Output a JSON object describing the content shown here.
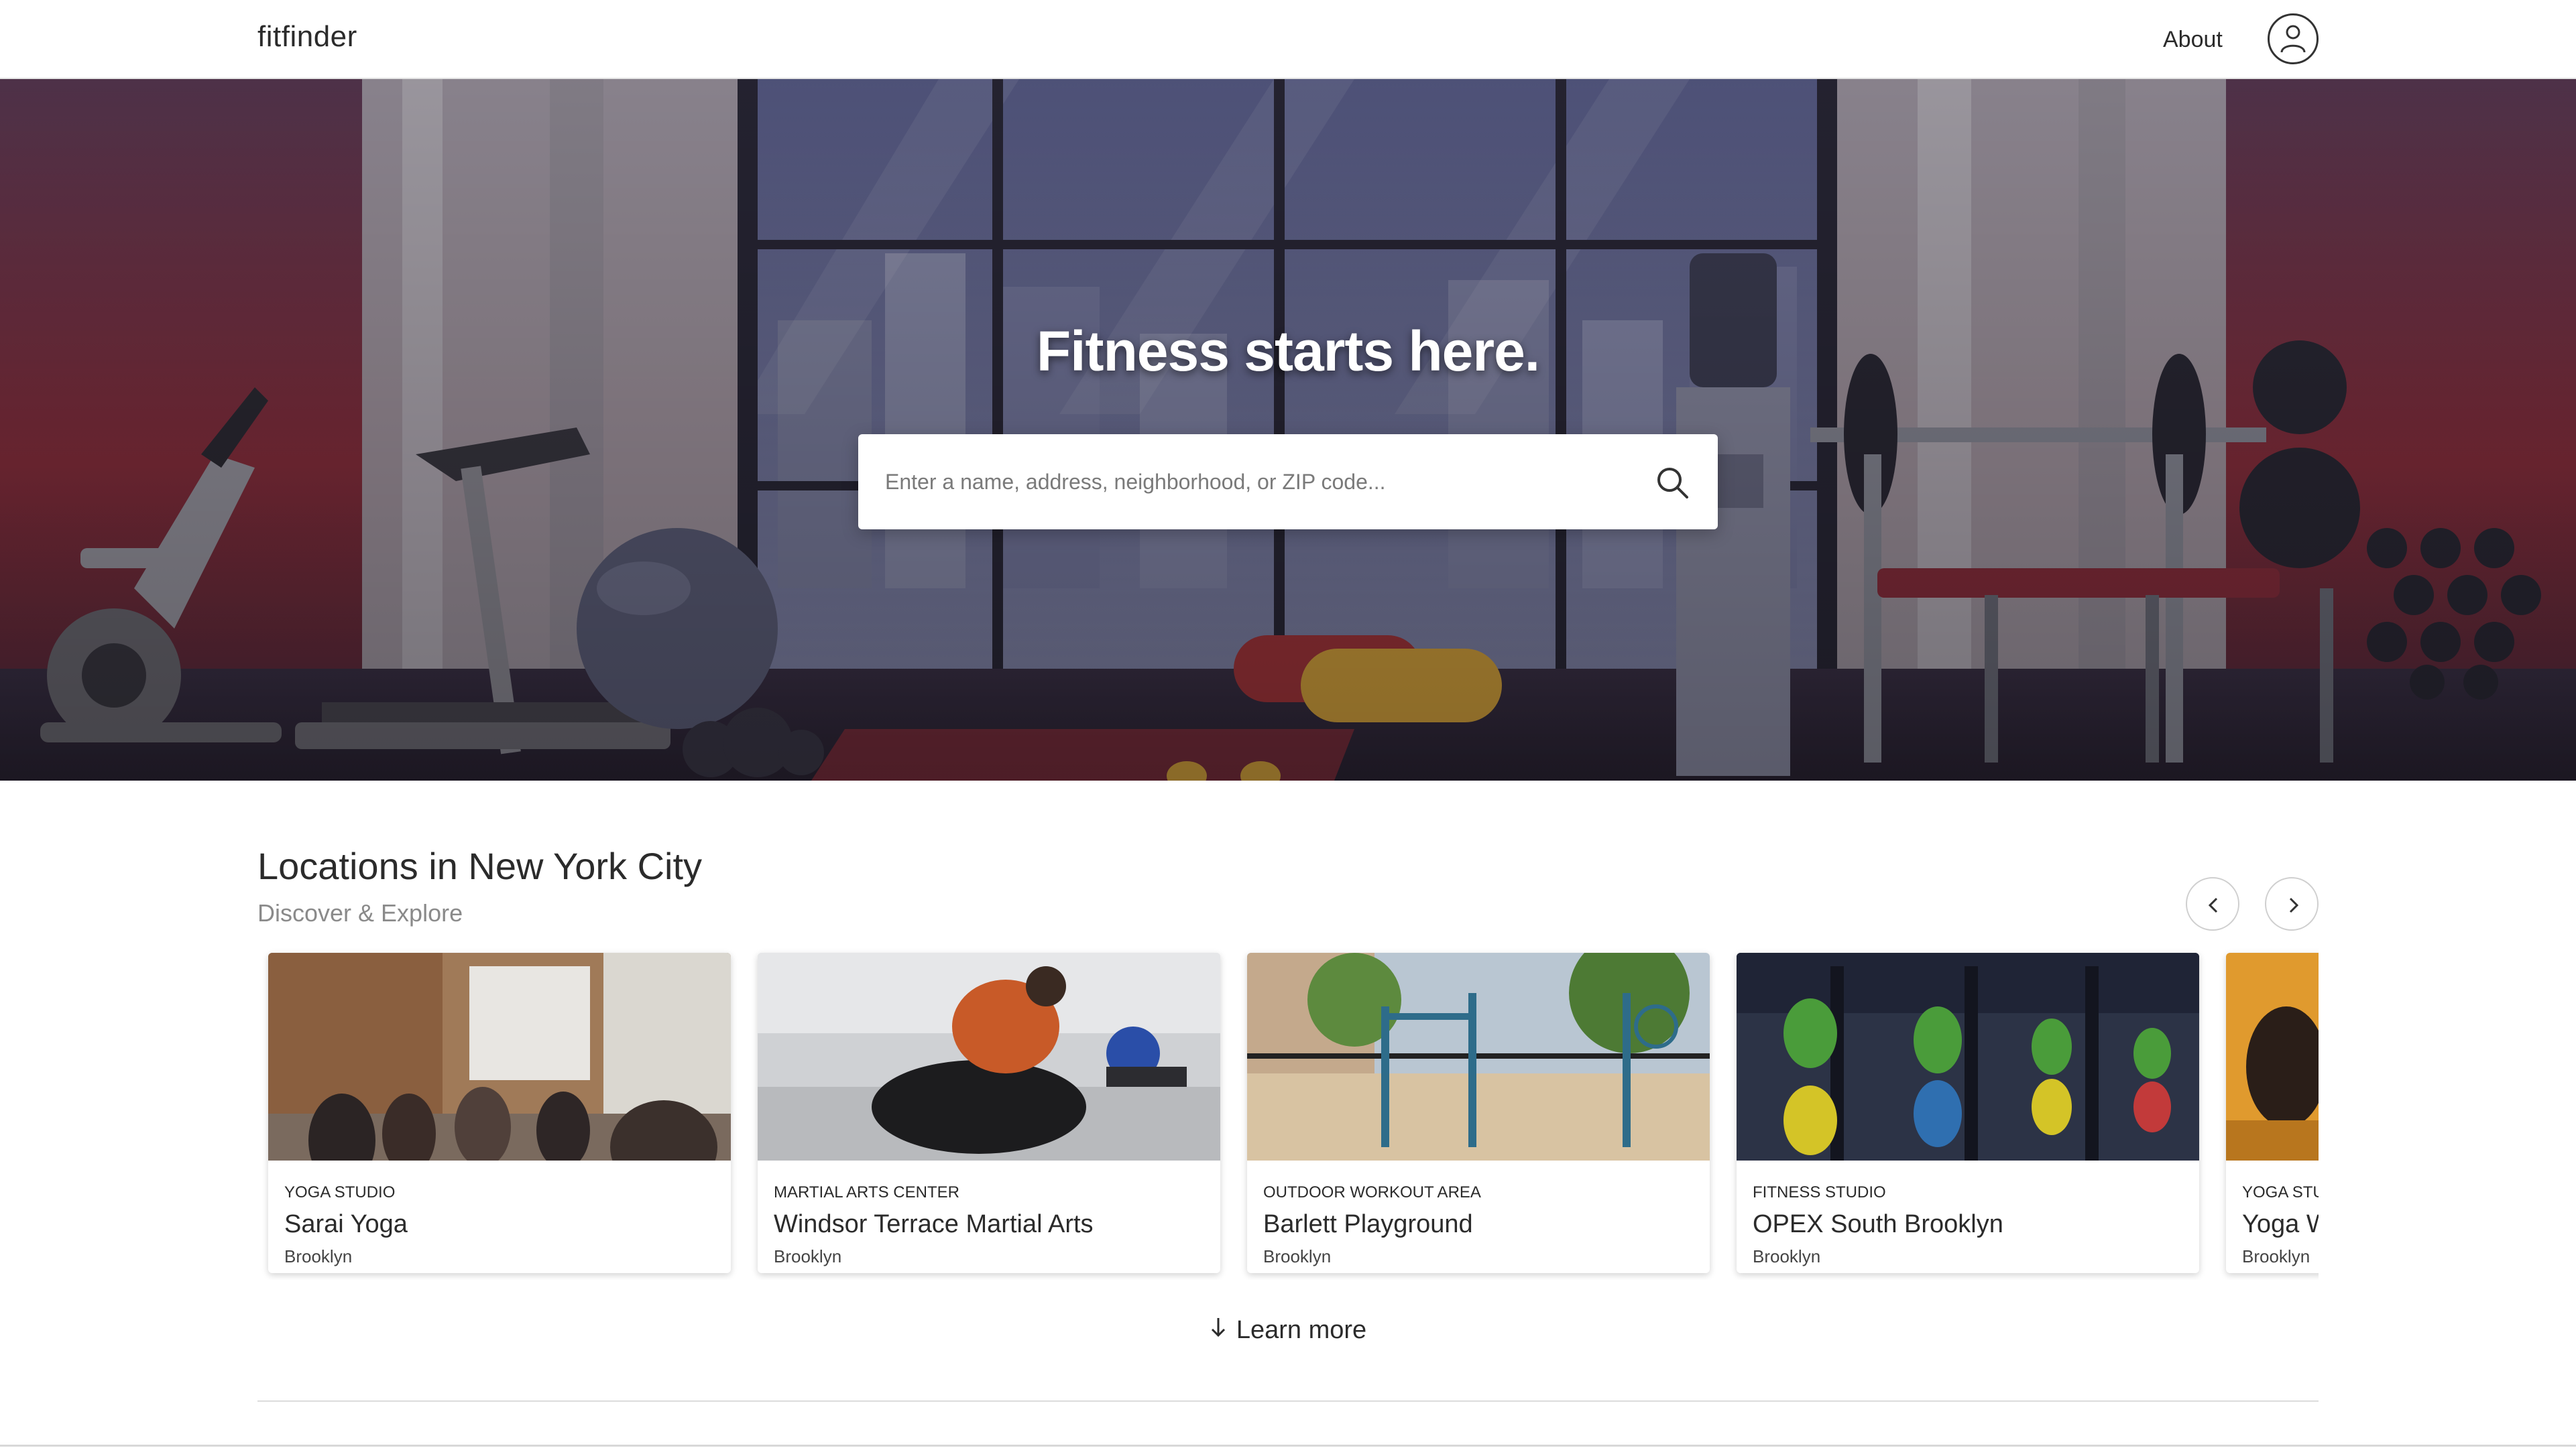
{
  "header": {
    "logo": "fitfinder",
    "about_label": "About",
    "avatar_icon": "user-icon"
  },
  "hero": {
    "title": "Fitness starts here.",
    "search_placeholder": "Enter a name, address, neighborhood, or ZIP code...",
    "search_icon": "search-icon"
  },
  "locations": {
    "title": "Locations in New York City",
    "subtitle": "Discover & Explore",
    "prev_icon": "chevron-left-icon",
    "next_icon": "chevron-right-icon",
    "cards": [
      {
        "category": "YOGA STUDIO",
        "name": "Sarai Yoga",
        "area": "Brooklyn"
      },
      {
        "category": "MARTIAL ARTS CENTER",
        "name": "Windsor Terrace Martial Arts",
        "area": "Brooklyn"
      },
      {
        "category": "OUTDOOR WORKOUT AREA",
        "name": "Barlett Playground",
        "area": "Brooklyn"
      },
      {
        "category": "FITNESS STUDIO",
        "name": "OPEX South Brooklyn",
        "area": "Brooklyn"
      },
      {
        "category": "YOGA STU",
        "name": "Yoga W",
        "area": "Brooklyn"
      }
    ]
  },
  "learn_more": {
    "label": "Learn more",
    "icon": "arrow-down-icon"
  },
  "colors": {
    "hero_wall": "#8a2f3e",
    "window_sky": "#6a6d94",
    "text_dark": "#2b2b2b",
    "subtitle_gray": "#8a8a8a"
  }
}
